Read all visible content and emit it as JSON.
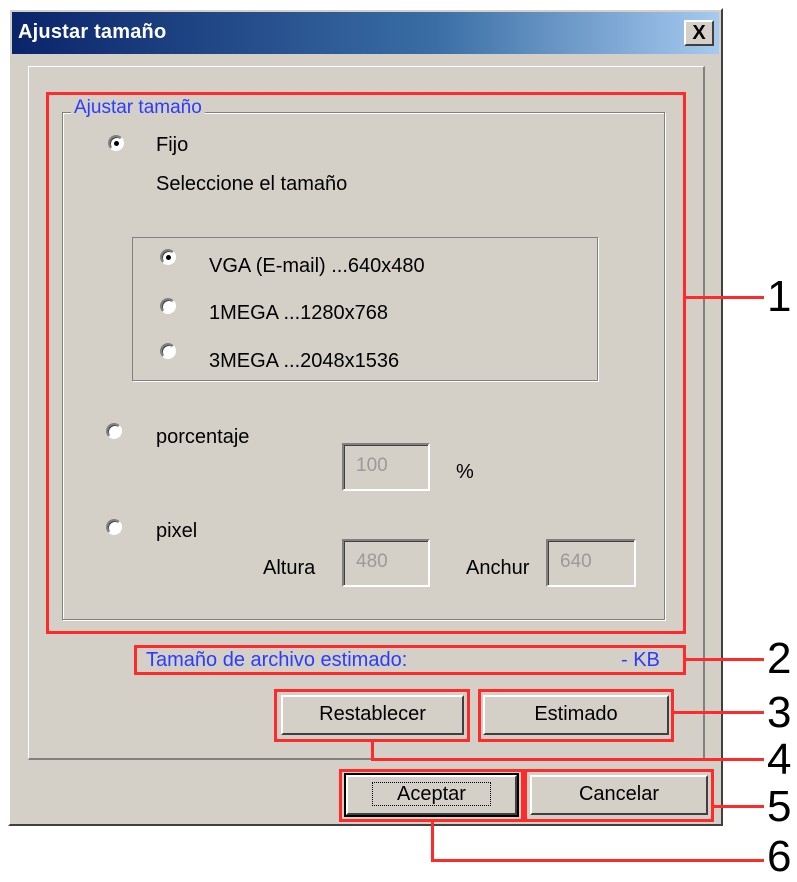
{
  "window": {
    "title": "Ajustar tamaño",
    "close_label": "X"
  },
  "group": {
    "legend": "Ajustar tamaño",
    "fixed": {
      "label": "Fijo",
      "checked": true
    },
    "select_size_label": "Seleccione el tamaño",
    "sizes": [
      {
        "label": "VGA (E-mail) ...640x480",
        "checked": true
      },
      {
        "label": "1MEGA ...1280x768",
        "checked": false
      },
      {
        "label": "3MEGA ...2048x1536",
        "checked": false
      }
    ],
    "percent": {
      "label": "porcentaje",
      "checked": false,
      "value": "100",
      "unit": "%"
    },
    "pixel": {
      "label": "pixel",
      "checked": false,
      "height_label": "Altura",
      "height_value": "480",
      "width_label": "Anchur",
      "width_value": "640"
    }
  },
  "estimate": {
    "label": "Tamaño de archivo estimado:",
    "value": "- KB"
  },
  "buttons": {
    "reset": "Restablecer",
    "estimate": "Estimado",
    "accept": "Aceptar",
    "cancel": "Cancelar"
  },
  "callouts": [
    "1",
    "2",
    "3",
    "4",
    "5",
    "6"
  ],
  "colors": {
    "dialog_bg": "#d4d0c8",
    "titlebar_start": "#0a246a",
    "titlebar_end": "#a6caf0",
    "annotation_red": "#ff2a2a",
    "link_blue": "#2b3bff"
  }
}
